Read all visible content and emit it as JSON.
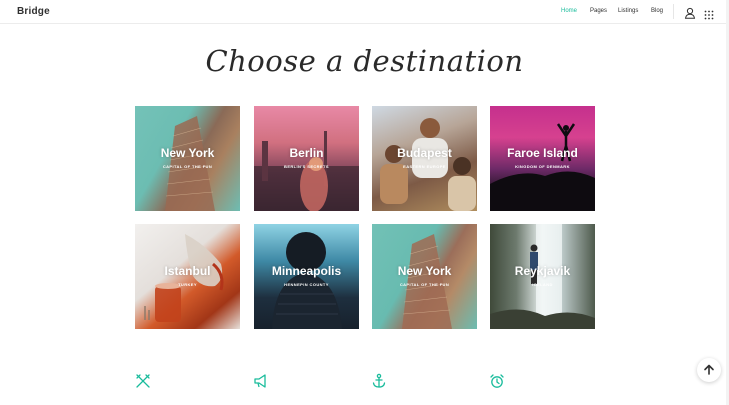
{
  "header": {
    "logo": "Bridge",
    "nav": [
      "Home",
      "Pages",
      "Listings",
      "Blog"
    ],
    "active_nav": "Home",
    "icons": [
      "user-icon",
      "grid-menu-icon"
    ]
  },
  "heading": "Choose a destination",
  "destinations": [
    {
      "name": "New York",
      "subtitle": "CAPITAL OF THE FUN"
    },
    {
      "name": "Berlin",
      "subtitle": "BERLIN'S SECRETS"
    },
    {
      "name": "Budapest",
      "subtitle": "EASTERN EUROPE"
    },
    {
      "name": "Faroe Island",
      "subtitle": "KINGDOM OF DENMARK"
    },
    {
      "name": "Istanbul",
      "subtitle": "TURKEY"
    },
    {
      "name": "Minneapolis",
      "subtitle": "HENNEPIN COUNTY"
    },
    {
      "name": "New York",
      "subtitle": "CAPITAL OF THE FUN"
    },
    {
      "name": "Reykjavik",
      "subtitle": "ICELAND"
    }
  ],
  "features": [
    {
      "icon": "restaurant-icon"
    },
    {
      "icon": "megaphone-icon"
    },
    {
      "icon": "anchor-icon"
    },
    {
      "icon": "alarm-clock-icon"
    }
  ],
  "colors": {
    "accent": "#1abc9c",
    "text": "#303030"
  },
  "back_to_top_icon": "arrow-up-icon"
}
